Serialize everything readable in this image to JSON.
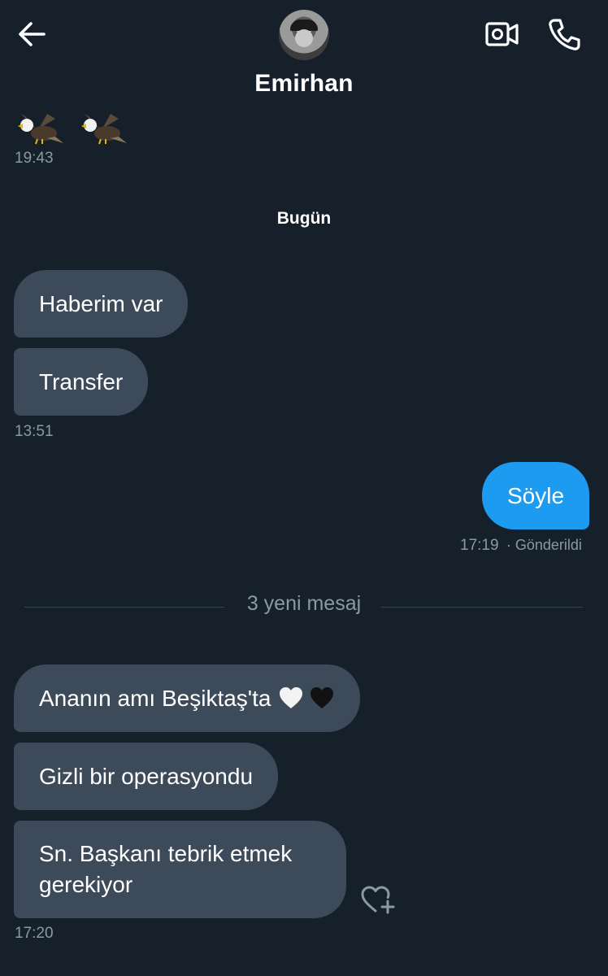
{
  "header": {
    "contact_name": "Emirhan",
    "back_icon": "arrow-left-icon",
    "video_icon": "video-call-icon",
    "phone_icon": "phone-icon"
  },
  "conversation": {
    "earlier": {
      "stickers": [
        "eagle-sticker",
        "eagle-sticker"
      ],
      "time": "19:43"
    },
    "date_separator": "Bugün",
    "group1": {
      "messages": [
        "Haberim var",
        "Transfer"
      ],
      "time": "13:51"
    },
    "outgoing": {
      "message": "Söyle",
      "time": "17:19",
      "status": "· Gönderildi"
    },
    "new_messages_label": "3 yeni mesaj",
    "group2": {
      "message1": "Ananın amı Beşiktaş'ta",
      "message1_emojis": [
        "white-heart-emoji",
        "black-heart-emoji"
      ],
      "message2": "Gizli bir operasyondu",
      "message3_line1": "Sn. Başkanı tebrik etmek",
      "message3_line2": "gerekiyor",
      "time": "17:20"
    },
    "reaction_icon": "add-reaction-heart-icon"
  },
  "colors": {
    "background": "#15202b",
    "incoming_bubble": "#3c4a5a",
    "outgoing_bubble": "#1d9bf0",
    "muted_text": "#8b98a5"
  }
}
